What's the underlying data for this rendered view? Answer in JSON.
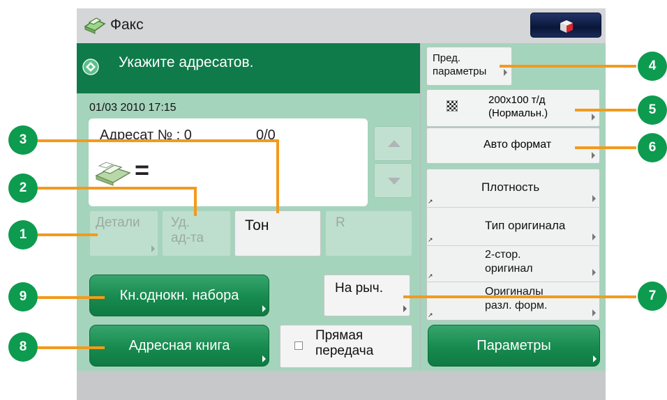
{
  "title": {
    "text": "Факс",
    "icon": "fax-icon"
  },
  "message": {
    "icon": "diamond-icon",
    "text": "Укажите адресатов."
  },
  "datetime": "01/03 2010 17:15",
  "recipient": {
    "label": "Адресат № : 0",
    "count": "0/0",
    "icon": "fax-machine-icon",
    "equals": "="
  },
  "buttons": {
    "details": "Детали",
    "remove_line1": "Уд.",
    "remove_line2": "ад-та",
    "tone": "Тон",
    "r": "R",
    "speed_dial": "Кн.однокн. набора",
    "on_hook": "На рыч.",
    "address_book": "Адресная книга",
    "direct_tx_line1": "Прямая",
    "direct_tx_line2": "передача",
    "parameters": "Параметры"
  },
  "right_panel": {
    "preset_line1": "Пред.",
    "preset_line2": "параметры",
    "resolution_line1": "200x100 т/д",
    "resolution_line2": "(Нормальн.)",
    "size": "Авто формат",
    "density": "Плотность",
    "orig_type": "Тип оригинала",
    "duplex_line1": "2-стор.",
    "duplex_line2": "оригинал",
    "mixed_line1": "Оригиналы",
    "mixed_line2": "разл. форм."
  },
  "callouts": [
    "1",
    "2",
    "3",
    "4",
    "5",
    "6",
    "7",
    "8",
    "9"
  ],
  "colors": {
    "accent_green": "#0f7a4a",
    "panel_green": "#a5d4bc",
    "callout_orange": "#f39a1c",
    "badge_green": "#0d9b4f"
  }
}
